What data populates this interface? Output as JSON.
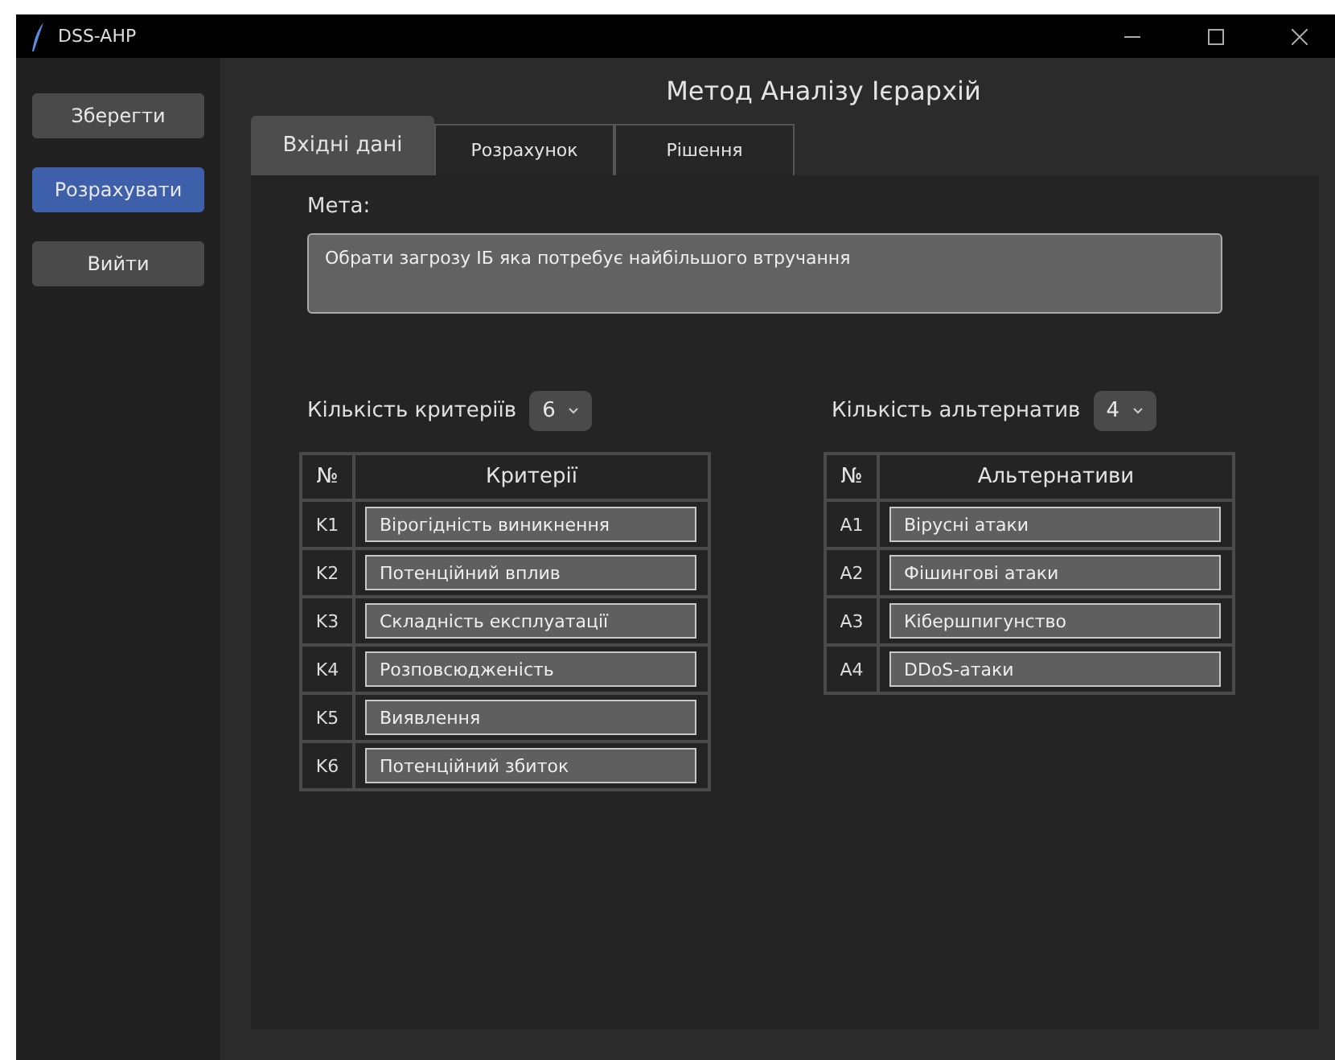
{
  "window": {
    "title": "DSS-AHP"
  },
  "sidebar": {
    "buttons": [
      {
        "label": "Зберегти",
        "selected": false
      },
      {
        "label": "Розрахувати",
        "selected": true
      },
      {
        "label": "Вийти",
        "selected": false
      }
    ]
  },
  "heading": "Метод Аналізу Ієрархій",
  "tabs": [
    {
      "label": "Вхідні дані",
      "selected": true
    },
    {
      "label": "Розрахунок",
      "selected": false
    },
    {
      "label": "Рішення",
      "selected": false
    }
  ],
  "goal": {
    "label": "Мета:",
    "value": "Обрати загрозу ІБ яка потребує найбільшого втручання"
  },
  "criteria": {
    "count_label": "Кількість критеріїв",
    "count": "6",
    "columns": [
      "№",
      "Критерії"
    ],
    "rows": [
      {
        "id": "K1",
        "name": "Вірогідність виникнення"
      },
      {
        "id": "K2",
        "name": "Потенційний вплив"
      },
      {
        "id": "K3",
        "name": "Складність експлуатації"
      },
      {
        "id": "K4",
        "name": "Розповсюдженість"
      },
      {
        "id": "K5",
        "name": "Виявлення"
      },
      {
        "id": "K6",
        "name": "Потенційний збиток"
      }
    ]
  },
  "alternatives": {
    "count_label": "Кількість альтернатив",
    "count": "4",
    "columns": [
      "№",
      "Альтернативи"
    ],
    "rows": [
      {
        "id": "A1",
        "name": "Вірусні атаки"
      },
      {
        "id": "A2",
        "name": "Фішингові атаки"
      },
      {
        "id": "A3",
        "name": "Кібершпигунство"
      },
      {
        "id": "A4",
        "name": "DDoS-атаки"
      }
    ]
  }
}
